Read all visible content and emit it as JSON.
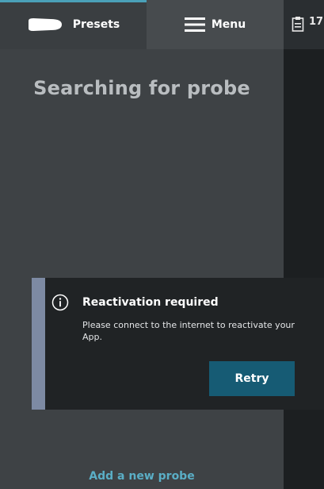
{
  "tabs": {
    "presets_label": "Presets",
    "menu_label": "Menu"
  },
  "status_strip": {
    "icon": "clipboard-icon",
    "number": "17"
  },
  "main": {
    "title": "Searching for probe",
    "add_probe_label": "Add a new probe"
  },
  "notification": {
    "icon": "info-icon",
    "title": "Reactivation required",
    "body": "Please connect to the internet to reactivate your App.",
    "retry_label": "Retry"
  },
  "colors": {
    "accent": "#4aa0b8",
    "button": "#165b74",
    "notification_bar": "#7d8aa3",
    "link": "#5aaec6"
  }
}
